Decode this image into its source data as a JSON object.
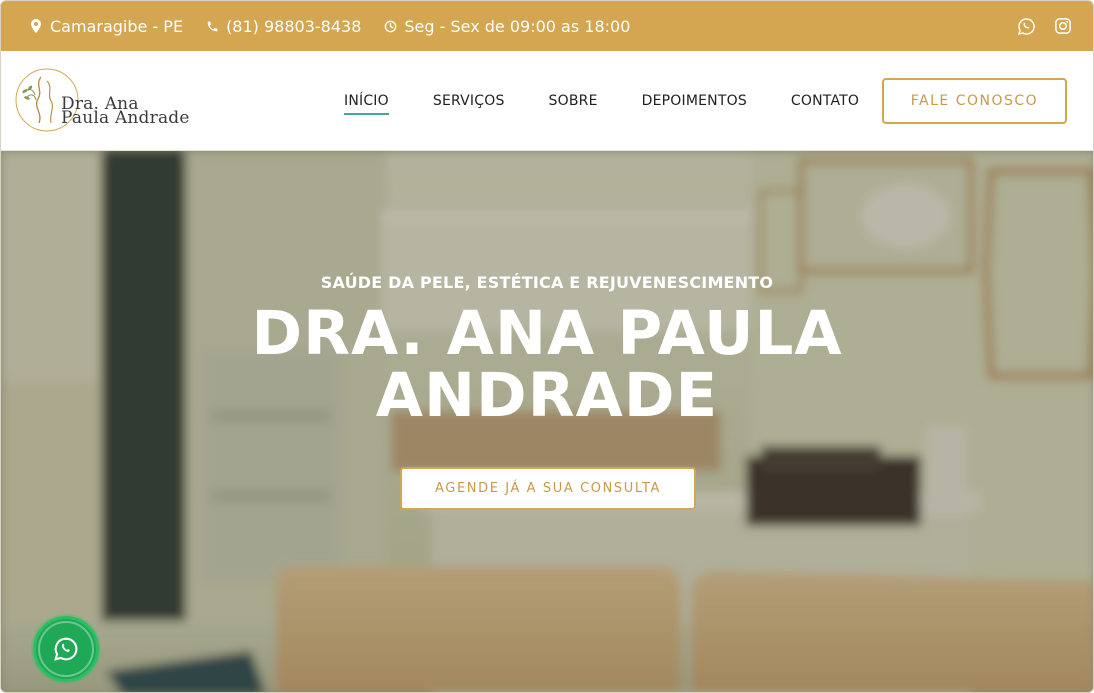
{
  "topbar": {
    "location": "Camaragibe - PE",
    "phone": "(81) 98803-8438",
    "hours": "Seg - Sex de 09:00 as 18:00",
    "icons": [
      "map-pin-icon",
      "phone-icon",
      "clock-icon",
      "whatsapp-icon",
      "instagram-icon"
    ],
    "color": "#d4a651"
  },
  "logo": {
    "line1": "Dra. Ana",
    "line2": "Paula Andrade"
  },
  "nav": {
    "items": [
      {
        "label": "INÍCIO",
        "active": true
      },
      {
        "label": "SERVIÇOS"
      },
      {
        "label": "SOBRE"
      },
      {
        "label": "DEPOIMENTOS"
      },
      {
        "label": "CONTATO"
      }
    ],
    "cta": "FALE CONOSCO"
  },
  "hero": {
    "subtitle": "SAÚDE DA PELE, ESTÉTICA E REJUVENESCIMENTO",
    "title_line1": "DRA. ANA PAULA",
    "title_line2": "ANDRADE",
    "cta": "AGENDE JÁ A SUA CONSULTA"
  },
  "floating": {
    "icon": "whatsapp-icon",
    "color": "#1fa855"
  },
  "colors": {
    "accent": "#d4a651",
    "nav_underline": "#4aa5a0"
  }
}
